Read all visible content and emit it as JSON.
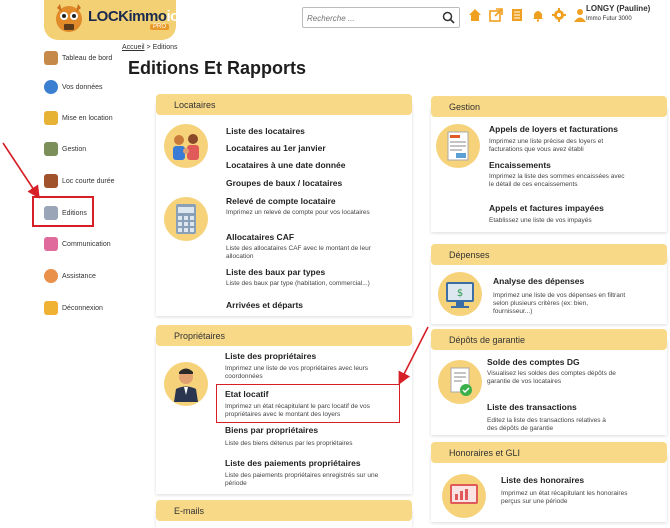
{
  "header": {
    "logo_text": "LOCKimmo",
    "logo_suffix": "io",
    "logo_badge": "PRO",
    "search_placeholder": "Recherche ...",
    "user_name": "LONGY (Pauline)",
    "user_org": "Immo Futur 3000"
  },
  "sidebar": {
    "items": [
      {
        "label": "Tableau de bord",
        "icon": "dashboard-icon",
        "color": "#c58a4a"
      },
      {
        "label": "Vos données",
        "icon": "user-data-icon",
        "color": "#3b7fd0"
      },
      {
        "label": "Mise en location",
        "icon": "keys-icon",
        "color": "#e7b334"
      },
      {
        "label": "Gestion",
        "icon": "management-icon",
        "color": "#7a8f5a"
      },
      {
        "label": "Loc courte durée",
        "icon": "suitcase-icon",
        "color": "#a0522d"
      },
      {
        "label": "Editions",
        "icon": "print-icon",
        "color": "#9aa5b8"
      },
      {
        "label": "Communication",
        "icon": "chat-icon",
        "color": "#e06a9b"
      },
      {
        "label": "Assistance",
        "icon": "support-icon",
        "color": "#e9904a"
      },
      {
        "label": "Déconnexion",
        "icon": "logout-icon",
        "color": "#f0b232"
      }
    ]
  },
  "breadcrumb": {
    "home": "Accueil",
    "sep": ">",
    "current": "Editions"
  },
  "page_title": "Editions Et Rapports",
  "locataires": {
    "header": "Locataires",
    "items": [
      {
        "title": "Liste des locataires",
        "desc": ""
      },
      {
        "title": "Locataires au 1er janvier",
        "desc": ""
      },
      {
        "title": "Locataires à une date donnée",
        "desc": ""
      },
      {
        "title": "Groupes de baux / locataires",
        "desc": ""
      },
      {
        "title": "Relevé de compte locataire",
        "desc": "Imprimez un relevé de compte pour vos locataires"
      },
      {
        "title": "Allocataires CAF",
        "desc": "Liste des allocataires CAF avec le montant de leur allocation"
      },
      {
        "title": "Liste des baux par types",
        "desc": "Liste des baux par type (habitation, commercial...)"
      },
      {
        "title": "Arrivées et départs",
        "desc": ""
      }
    ]
  },
  "proprietaires": {
    "header": "Propriétaires",
    "items": [
      {
        "title": "Liste des propriétaires",
        "desc": "Imprimez une liste de vos propriétaires avec leurs coordonnées"
      },
      {
        "title": "Etat locatif",
        "desc": "Imprimez un état récapitulant le parc locatif de vos propriétaires avec le montant des loyers"
      },
      {
        "title": "Biens par propriétaires",
        "desc": "Liste des biens détenus par les propriétaires"
      },
      {
        "title": "Liste des paiements propriétaires",
        "desc": "Liste des paiements propriétaires enregistrés sur une période"
      }
    ]
  },
  "emails": {
    "header": "E-mails"
  },
  "gestion": {
    "header": "Gestion",
    "items": [
      {
        "title": "Appels de loyers et facturations",
        "desc": "Imprimez une liste précise des loyers et facturations que vous avez établi"
      },
      {
        "title": "Encaissements",
        "desc": "Imprimez la liste des sommes encaissées avec le détail de ces encaissements"
      },
      {
        "title": "Appels et factures impayées",
        "desc": "Etablissez une liste de vos impayés"
      }
    ]
  },
  "depenses": {
    "header": "Dépenses",
    "items": [
      {
        "title": "Analyse des dépenses",
        "desc": "Imprimez une liste de vos dépenses en filtrant selon plusieurs critères (ex: bien, fournisseur...)"
      }
    ]
  },
  "depots": {
    "header": "Dépôts de garantie",
    "items": [
      {
        "title": "Solde des comptes DG",
        "desc": "Visualisez les soldes des comptes dépôts de garantie de vos locataires"
      },
      {
        "title": "Liste des transactions",
        "desc": "Editez la liste des transactions relatives à des dépôts de garantie"
      }
    ]
  },
  "honoraires": {
    "header": "Honoraires et GLI",
    "items": [
      {
        "title": "Liste des honoraires",
        "desc": "Imprimez un état récapitulant les honoraires perçus sur une période"
      }
    ]
  },
  "colors": {
    "accent": "#f8d988",
    "annotation": "#d61f26",
    "brand_dark": "#1a2a4f"
  }
}
